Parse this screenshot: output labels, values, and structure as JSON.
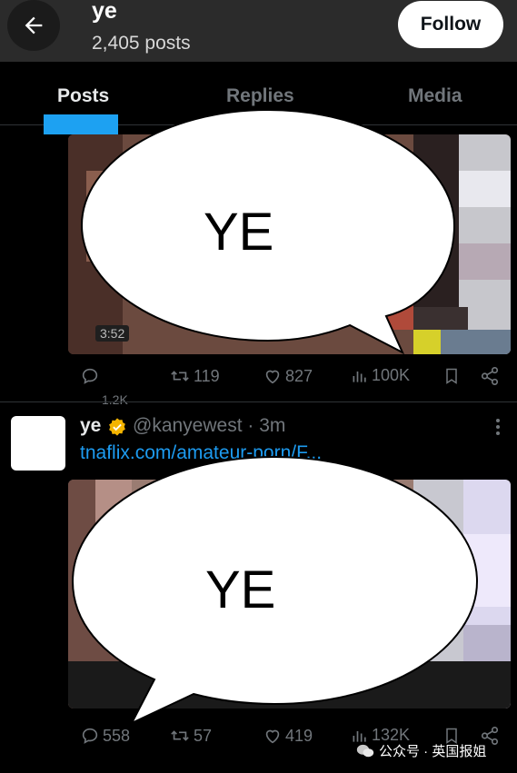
{
  "header": {
    "title": "ye",
    "post_count": "2,405 posts",
    "follow_label": "Follow"
  },
  "tabs": [
    {
      "label": "Posts",
      "active": true
    },
    {
      "label": "Replies",
      "active": false
    },
    {
      "label": "Media",
      "active": false
    }
  ],
  "post1": {
    "bubble_text": "YE",
    "video_time": "3:52",
    "actions": {
      "retweets": "119",
      "likes": "827",
      "views": "100K"
    },
    "truncated_text": "1.2K"
  },
  "post2": {
    "name": "ye",
    "handle": "@kanyewest · 3m",
    "link": "tnaflix.com/amateur-porn/F...",
    "bubble_text": "YE",
    "actions": {
      "replies": "558",
      "retweets": "57",
      "likes": "419",
      "views": "132K"
    }
  },
  "watermark": {
    "text": "公众号 · 英国报姐"
  },
  "colors": {
    "accent": "#1d9bf0",
    "muted": "#71767b",
    "verified": "#f4b400"
  }
}
